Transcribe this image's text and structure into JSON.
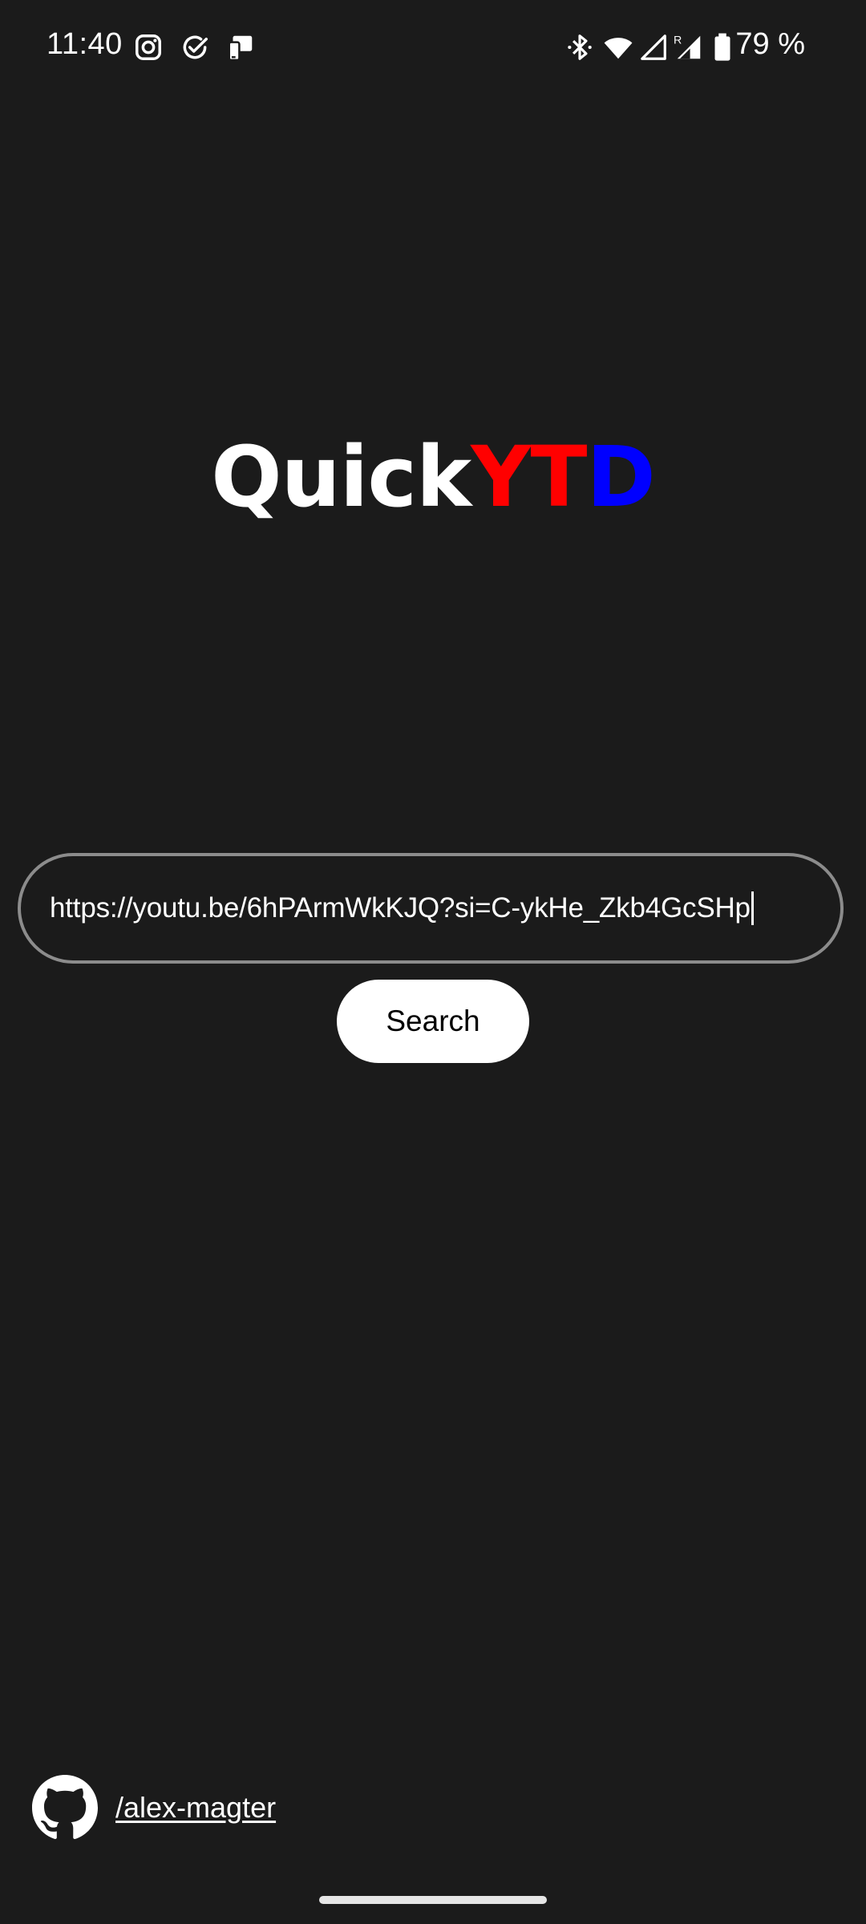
{
  "status_bar": {
    "time": "11:40",
    "left_icons": [
      "instagram-icon",
      "check-circle-icon",
      "screen-cast-icon"
    ],
    "right_icons": [
      "bluetooth-icon",
      "wifi-icon",
      "cell-signal-icon",
      "cell-signal-roaming-icon",
      "battery-icon"
    ],
    "roaming_label": "R",
    "battery_text": "79 %"
  },
  "logo": {
    "part_quick": "Quick",
    "part_yt": "YT",
    "part_d": "D",
    "colors": {
      "quick": "#ffffff",
      "yt": "#ff0000",
      "d": "#0000ff"
    }
  },
  "search": {
    "value": "https://youtu.be/6hPArmWkKJQ?si=C-ykHe_Zkb4GcSHp",
    "button_label": "Search"
  },
  "footer": {
    "icon": "github-icon",
    "link_text": "/alex-magter"
  },
  "theme": {
    "background": "#1b1b1b",
    "input_border": "#8c8c8c",
    "button_bg": "#ffffff"
  }
}
